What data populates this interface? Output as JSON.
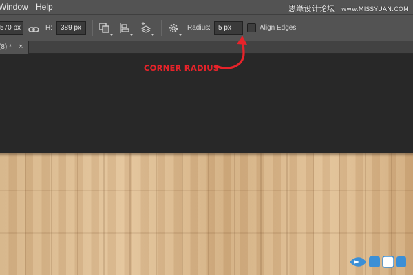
{
  "menubar": {
    "items": [
      "Window",
      "Help"
    ],
    "watermark_text": "思缘设计论坛",
    "watermark_url": "www.MISSYUAN.COM"
  },
  "options": {
    "width_value": "570 px",
    "height_label": "H:",
    "height_value": "389 px",
    "radius_label": "Radius:",
    "radius_value": "5 px",
    "align_edges_label": "Align Edges",
    "align_edges_checked": false
  },
  "tab": {
    "label": "(8) *",
    "close_glyph": "×"
  },
  "annotation": {
    "text": "CORNER RADIUS",
    "color": "#e8232a"
  },
  "colors": {
    "ui_panel": "#535353",
    "workspace": "#282828",
    "wood": "#d8b68c"
  },
  "icons": [
    "link-icon",
    "path-operations-icon",
    "path-alignment-icon",
    "path-arrangement-icon",
    "gear-icon"
  ]
}
